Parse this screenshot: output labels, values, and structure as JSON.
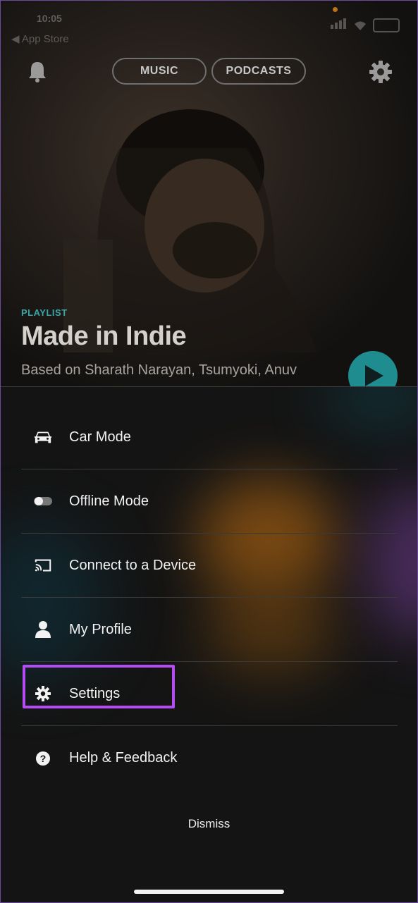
{
  "status_bar": {
    "time": "10:05",
    "back_label": "◀ App Store"
  },
  "header": {
    "tabs": [
      {
        "label": "MUSIC"
      },
      {
        "label": "PODCASTS"
      }
    ],
    "bell_icon": "bell-icon",
    "settings_icon": "gear-icon"
  },
  "hero": {
    "tag": "PLAYLIST",
    "title": "Made in Indie",
    "subtitle": "Based on Sharath Narayan, Tsumyoki, Anuv"
  },
  "menu": {
    "items": [
      {
        "label": "Car Mode",
        "icon": "car-icon"
      },
      {
        "label": "Offline Mode",
        "icon": "toggle-icon"
      },
      {
        "label": "Connect to a Device",
        "icon": "cast-icon"
      },
      {
        "label": "My Profile",
        "icon": "user-icon"
      },
      {
        "label": "Settings",
        "icon": "gear-icon",
        "highlighted": true
      },
      {
        "label": "Help & Feedback",
        "icon": "question-icon"
      }
    ],
    "dismiss_label": "Dismiss"
  },
  "colors": {
    "accent_teal": "#1f8d90",
    "highlight": "#b54cf2"
  }
}
